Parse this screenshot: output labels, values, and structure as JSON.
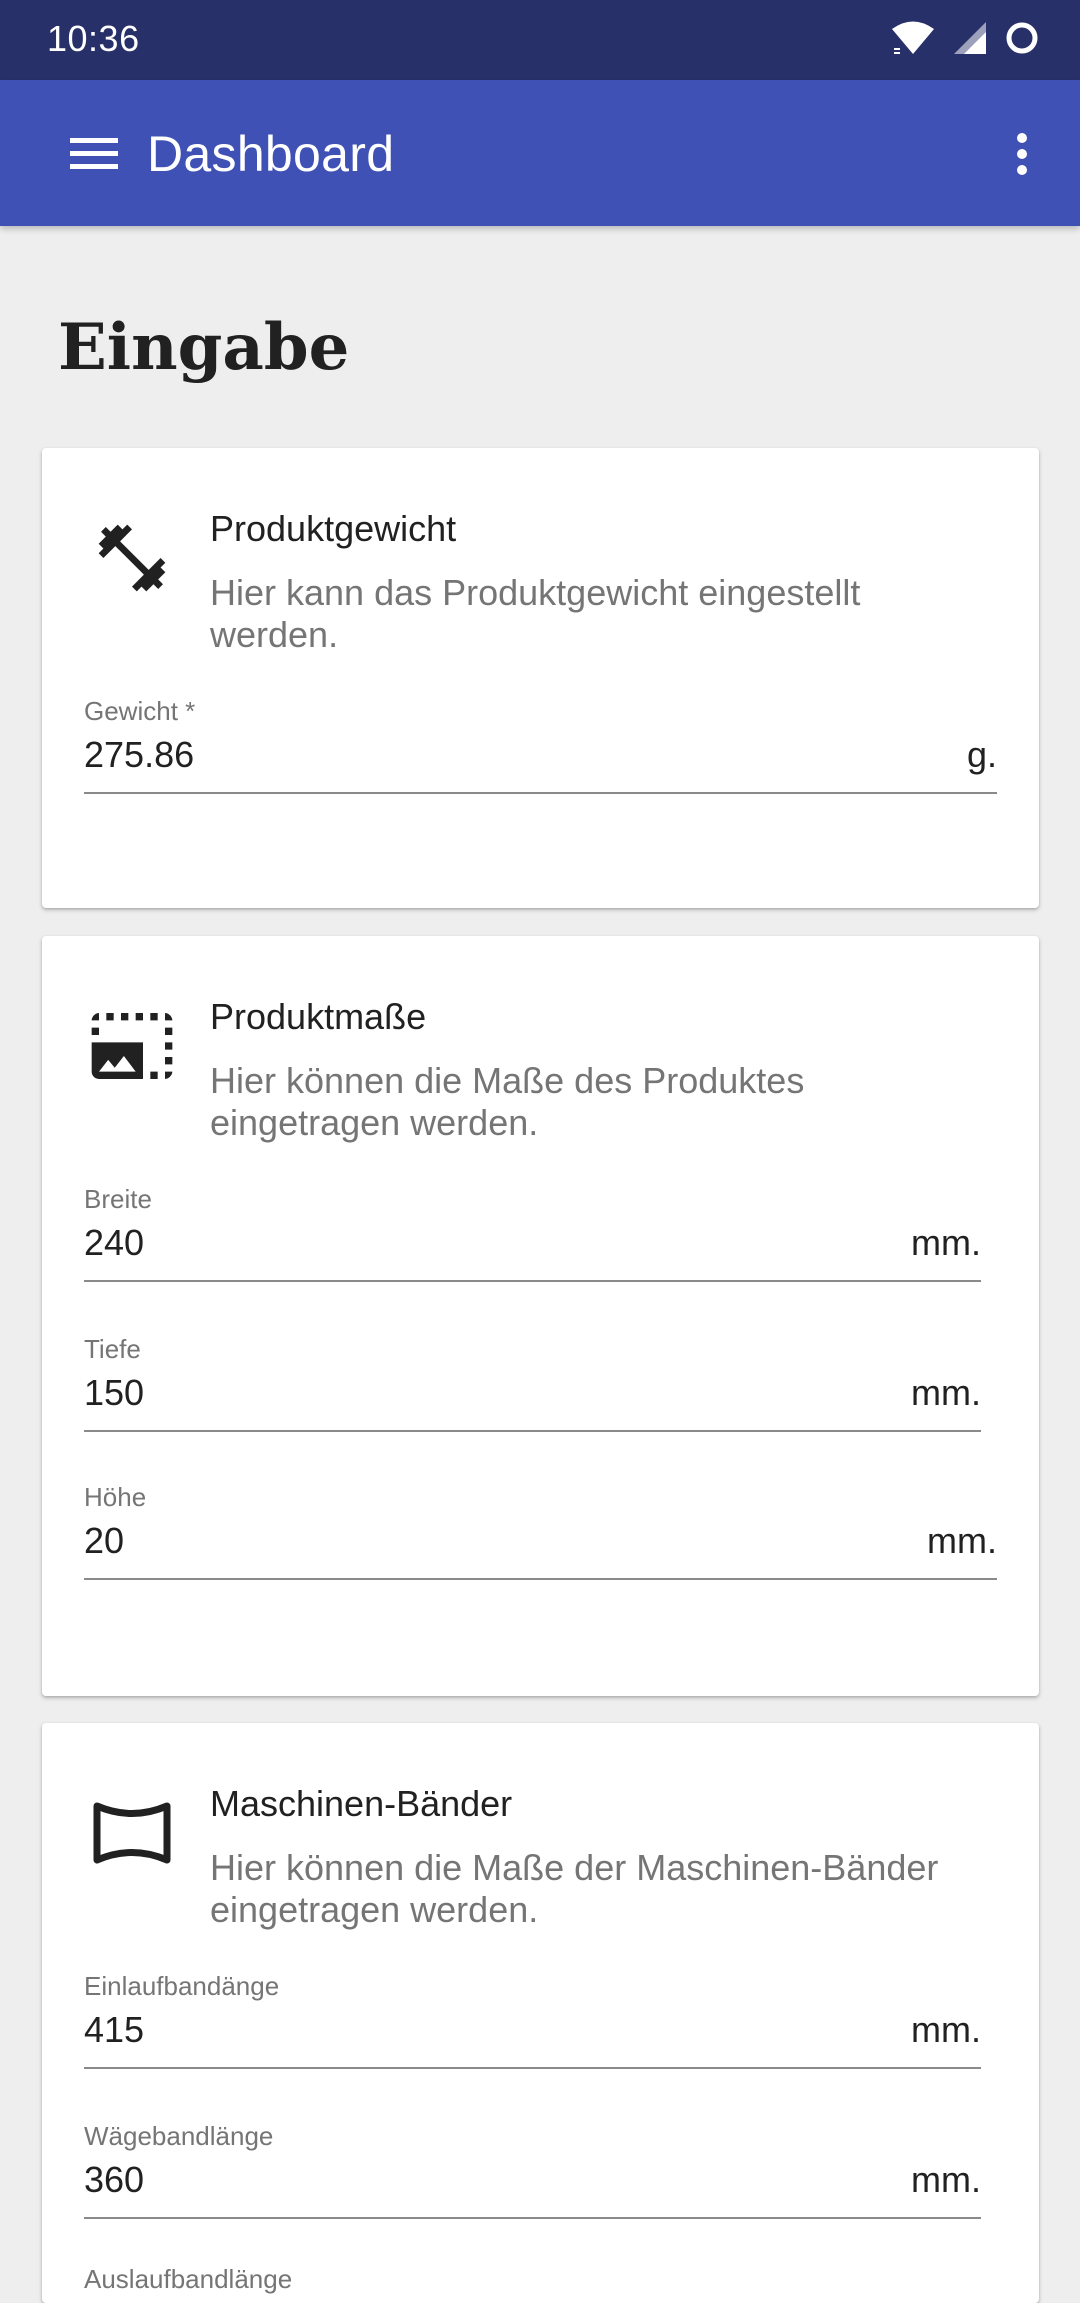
{
  "status_bar": {
    "time": "10:36",
    "icons": [
      "wifi-icon",
      "cell-signal-icon",
      "battery-icon"
    ]
  },
  "app_bar": {
    "title": "Dashboard",
    "menu_icon": "hamburger-menu-icon",
    "overflow_icon": "more-vert-icon",
    "color": "#3f51b5"
  },
  "page": {
    "title": "Eingabe"
  },
  "cards": {
    "weight": {
      "icon": "dumbbell-icon",
      "title": "Produktgewicht",
      "description": "Hier kann das Produktgewicht eingestellt werden.",
      "fields": [
        {
          "label": "Gewicht *",
          "value": "275.86",
          "unit": "g."
        }
      ]
    },
    "dimensions": {
      "icon": "photo-size-select-icon",
      "title": "Produktmaße",
      "description": "Hier können die Maße des Produktes eingetragen werden.",
      "fields": [
        {
          "label": "Breite",
          "value": "240",
          "unit": "mm."
        },
        {
          "label": "Tiefe",
          "value": "150",
          "unit": "mm."
        },
        {
          "label": "Höhe",
          "value": "20",
          "unit": "mm."
        }
      ]
    },
    "belts": {
      "icon": "panorama-belt-icon",
      "title": "Maschinen-Bänder",
      "description": "Hier können die Maße der Maschinen-Bänder eingetragen werden.",
      "fields": [
        {
          "label": "Einlaufbandänge",
          "value": "415",
          "unit": "mm."
        },
        {
          "label": "Wägebandlänge",
          "value": "360",
          "unit": "mm."
        }
      ],
      "partial_label": "Auslaufbandlänge"
    }
  },
  "colors": {
    "status_bar": "#283069",
    "app_bar": "#3f51b5",
    "background": "#eeeeee",
    "card": "#ffffff"
  }
}
